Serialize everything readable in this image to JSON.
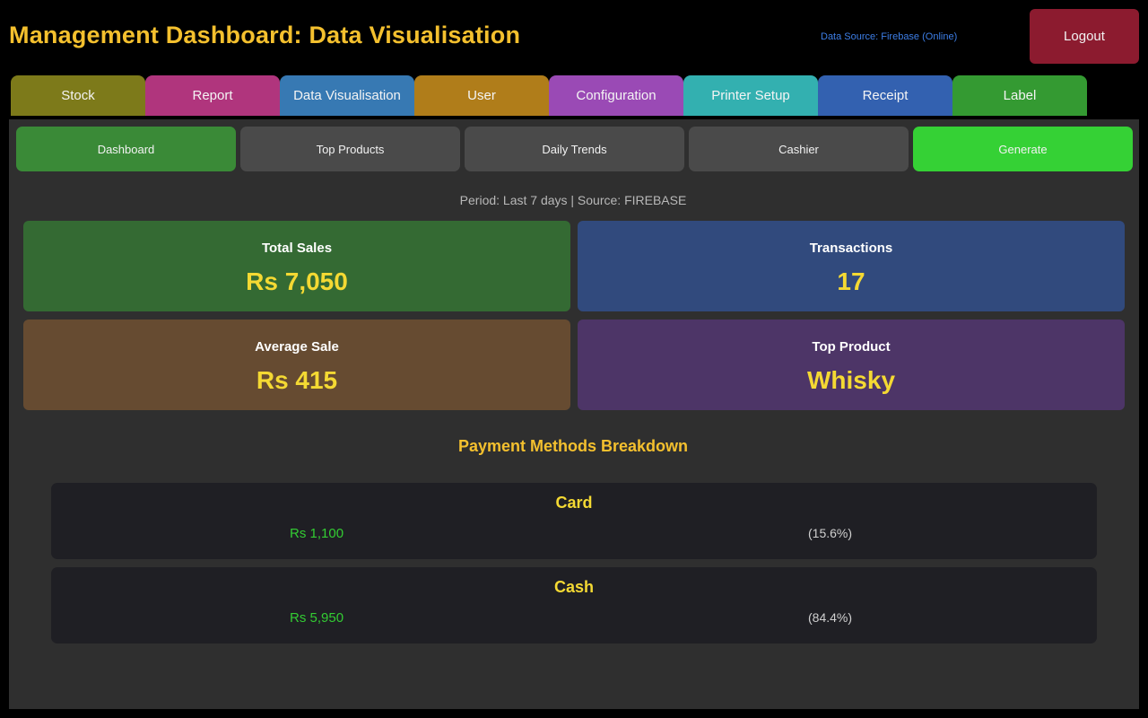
{
  "header": {
    "title": "Management Dashboard: Data Visualisation",
    "data_source": "Data Source: Firebase (Online)",
    "logout_label": "Logout"
  },
  "tabs": [
    {
      "label": "Stock",
      "color": "#7d7a1a"
    },
    {
      "label": "Report",
      "color": "#b0357d"
    },
    {
      "label": "Data Visualisation",
      "color": "#3779b3"
    },
    {
      "label": "User",
      "color": "#b07d1a"
    },
    {
      "label": "Configuration",
      "color": "#9a4ab5"
    },
    {
      "label": "Printer Setup",
      "color": "#33b0b0"
    },
    {
      "label": "Receipt",
      "color": "#3361b0"
    },
    {
      "label": "Label",
      "color": "#349a32"
    }
  ],
  "subnav": {
    "dashboard": "Dashboard",
    "top_products": "Top Products",
    "daily_trends": "Daily Trends",
    "cashier": "Cashier",
    "generate": "Generate"
  },
  "period_text": "Period: Last 7 days | Source: FIREBASE",
  "cards": {
    "total_sales": {
      "label": "Total Sales",
      "value": "Rs 7,050"
    },
    "transactions": {
      "label": "Transactions",
      "value": "17"
    },
    "average_sale": {
      "label": "Average Sale",
      "value": "Rs 415"
    },
    "top_product": {
      "label": "Top Product",
      "value": "Whisky"
    }
  },
  "payment_section_title": "Payment Methods Breakdown",
  "payments": [
    {
      "method": "Card",
      "amount": "Rs 1,100",
      "percent": "(15.6%)"
    },
    {
      "method": "Cash",
      "amount": "Rs 5,950",
      "percent": "(84.4%)"
    }
  ]
}
